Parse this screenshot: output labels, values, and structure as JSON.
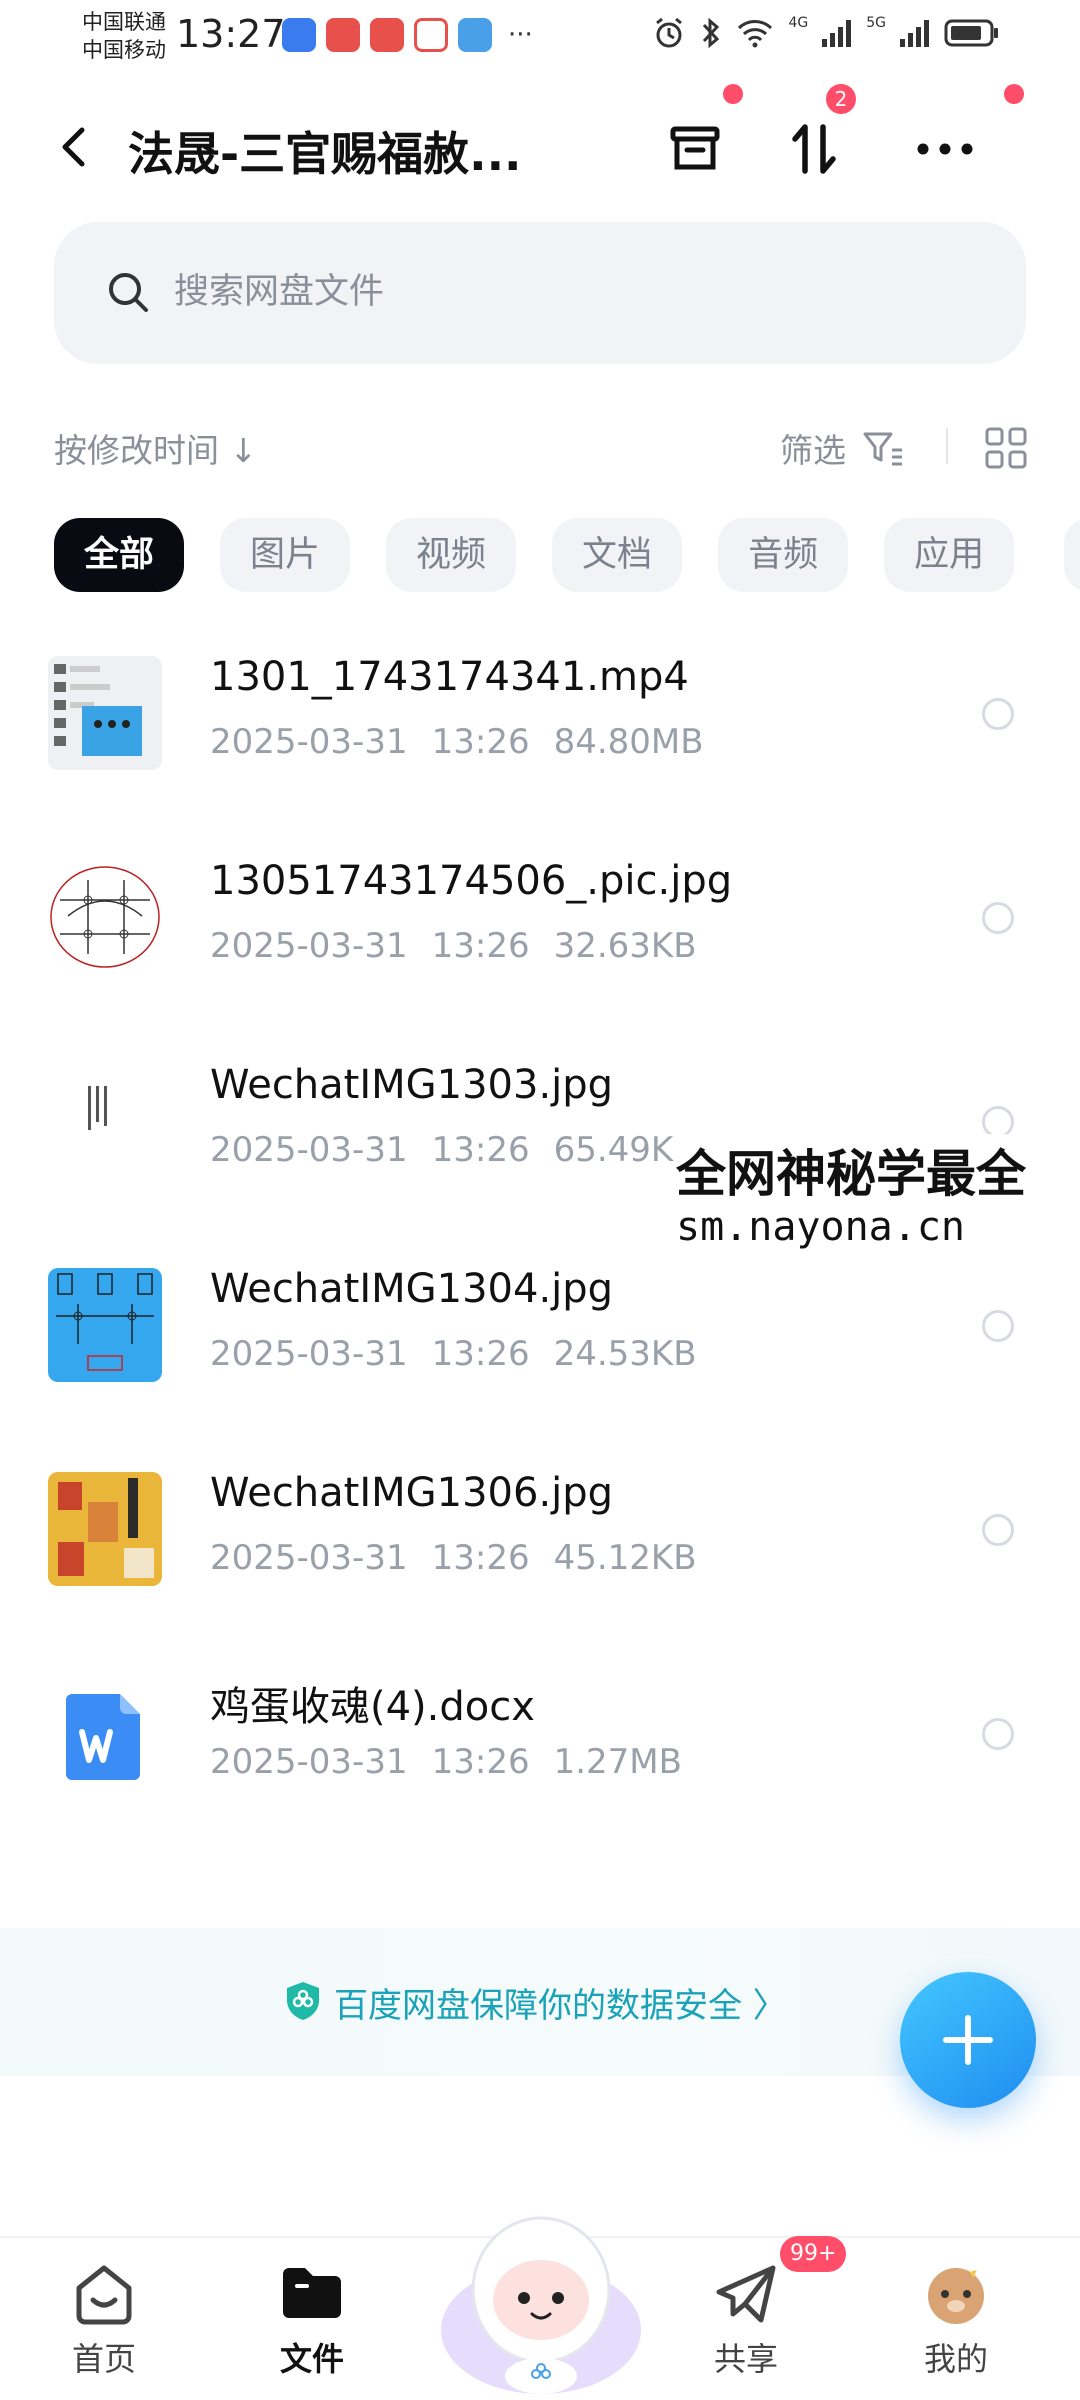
{
  "status_bar": {
    "carrier_1": "中国联通",
    "carrier_2": "中国移动",
    "time": "13:27",
    "more": "···",
    "net_1": "4G",
    "net_2": "5G",
    "app_icon_colors": [
      "#3b7bf0",
      "#e8504c",
      "#e8504c",
      "#e8504c",
      "#4aa0e8"
    ]
  },
  "header": {
    "title": "法晟-三官赐福赦...",
    "transfer_badge": "2"
  },
  "search": {
    "placeholder": "搜索网盘文件",
    "value": ""
  },
  "sort_bar": {
    "sort_label": "按修改时间 ↓",
    "filter_label": "筛选"
  },
  "chips": [
    "全部",
    "图片",
    "视频",
    "文档",
    "音频",
    "应用"
  ],
  "files": [
    {
      "name": "1301_1743174341.mp4",
      "date": "2025-03-31",
      "time": "13:26",
      "size": "84.80MB",
      "thumb": "video"
    },
    {
      "name": "13051743174506_.pic.jpg",
      "date": "2025-03-31",
      "time": "13:26",
      "size": "32.63KB",
      "thumb": "diagram"
    },
    {
      "name": "WechatIMG1303.jpg",
      "date": "2025-03-31",
      "time": "13:26",
      "size": "65.49KB",
      "thumb": "text-image"
    },
    {
      "name": "WechatIMG1304.jpg",
      "date": "2025-03-31",
      "time": "13:26",
      "size": "24.53KB",
      "thumb": "blue-image"
    },
    {
      "name": "WechatIMG1306.jpg",
      "date": "2025-03-31",
      "time": "13:26",
      "size": "45.12KB",
      "thumb": "talisman"
    },
    {
      "name": "鸡蛋收魂(4).docx",
      "date": "2025-03-31",
      "time": "13:26",
      "size": "1.27MB",
      "thumb": "word-doc"
    }
  ],
  "watermark": {
    "line_1": "全网神秘学最全",
    "line_2": "sm.nayona.cn"
  },
  "security_banner": {
    "text": "百度网盘保障你的数据安全 〉"
  },
  "bottom_nav": {
    "items": [
      {
        "label": "首页",
        "icon": "home-icon"
      },
      {
        "label": "文件",
        "icon": "folder-icon"
      },
      {
        "label": "共享",
        "icon": "share-icon"
      },
      {
        "label": "我的",
        "icon": "profile-avatar-icon"
      }
    ],
    "share_badge": "99+"
  },
  "colors": {
    "accent": "#1e8df0",
    "badge": "#ff4d6a",
    "chip_active": "#0a0a12",
    "secure_text": "#1aa3b8"
  }
}
